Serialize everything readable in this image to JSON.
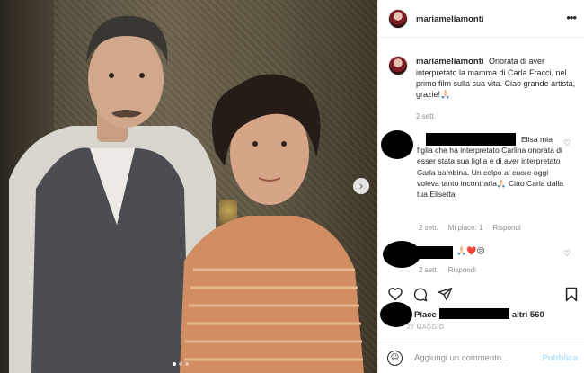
{
  "header": {
    "username": "mariameliamonti",
    "more_icon": "more-horizontal-icon"
  },
  "caption": {
    "username": "mariameliamonti",
    "text": "Onorata di aver interpretato la mamma di Carla Fracci, nel primo film sulla sua vita. Ciao grande artista, grazie!🙏🏻",
    "time": "2 sett."
  },
  "comments": [
    {
      "text": "Elisa mia figlia che ha interpretato Carlina onorata di esser stata sua figlia e di aver interpretato Carla bambina. Un colpo al cuore oggi voleva tanto incontrarla🙏🏻 Ciao Carla dalla tua Elisetta",
      "time": "2 sett.",
      "likes": "Mi piace: 1",
      "reply": "Rispondi"
    },
    {
      "text": "🙏🏻❤️😢",
      "time": "2 sett.",
      "reply": "Rispondi"
    }
  ],
  "actions": {
    "like_icon": "heart-icon",
    "comment_icon": "comment-icon",
    "share_icon": "share-icon",
    "save_icon": "bookmark-icon"
  },
  "likes_text_prefix": "Piace",
  "likes_text_suffix": "altri 560",
  "date": "27 MAGGIO",
  "add_comment": {
    "placeholder": "Aggiungi un commento...",
    "publish_label": "Pubblica"
  },
  "colors": {
    "publish_disabled": "#b2dffc",
    "secondary_text": "#8e8e8e",
    "heart_red": "#ed4956"
  }
}
